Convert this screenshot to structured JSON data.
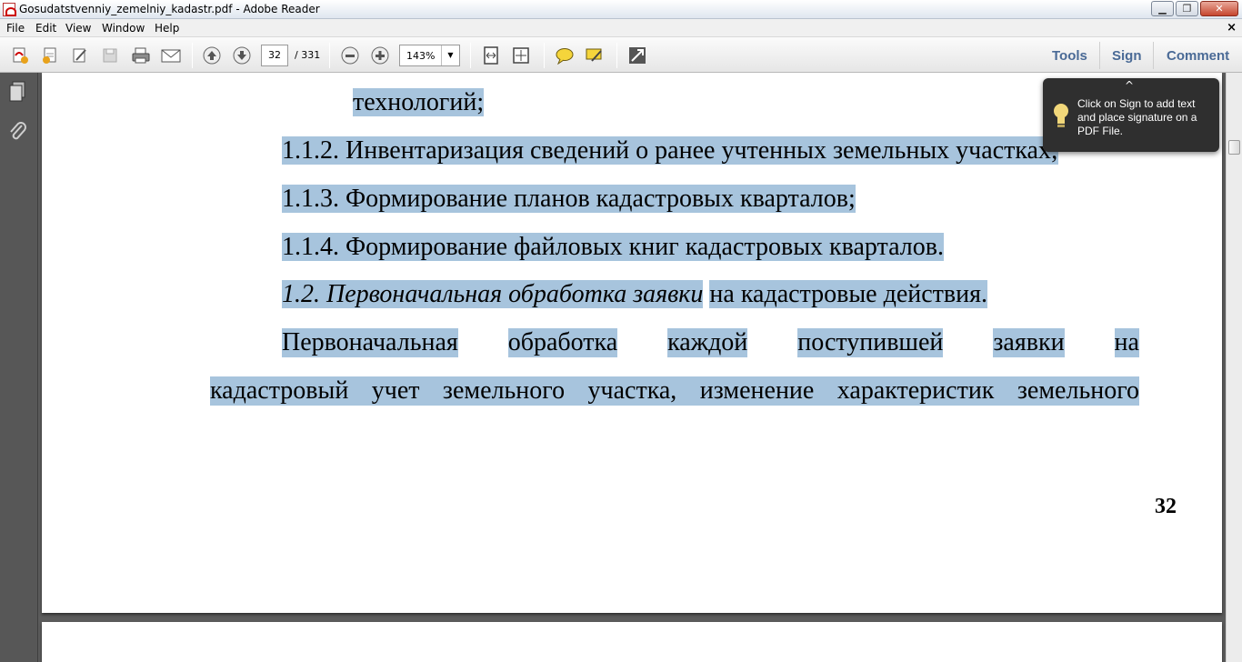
{
  "window": {
    "title": "Gosudatstvenniy_zemelniy_kadastr.pdf - Adobe Reader",
    "controls": {
      "minimize": "▁",
      "maximize": "❐",
      "close": "✕"
    }
  },
  "menubar": {
    "items": [
      "File",
      "Edit",
      "View",
      "Window",
      "Help"
    ],
    "close_document": "×"
  },
  "toolbar": {
    "buttons": [
      "create-pdf-icon",
      "export-icon",
      "edit-icon",
      "save-icon",
      "print-icon",
      "email-icon",
      "previous-page-icon",
      "next-page-icon",
      "zoom-out-icon",
      "zoom-in-icon",
      "fit-page-icon",
      "fit-width-icon",
      "comment-icon",
      "highlight-icon",
      "fullscreen-icon"
    ],
    "page_current": "32",
    "page_total": "/ 331",
    "zoom": "143%",
    "panes": [
      "Tools",
      "Sign",
      "Comment"
    ]
  },
  "document": {
    "lines": [
      {
        "text": "технологий;"
      },
      {
        "num": "1.1.2.",
        "text": "Инвентаризация сведений о ранее учтенных земельных участках;"
      },
      {
        "num": "1.1.3.",
        "text": "Формирование планов кадастровых кварталов;"
      },
      {
        "num": "1.1.4.",
        "text": "Формирование файловых книг кадастровых кварталов."
      },
      {
        "italic": "1.2. Первоначальная обработка заявки",
        "text": "на кадастровые действия."
      },
      {
        "words": [
          "Первоначальная",
          "обработка",
          "каждой",
          "поступившей",
          "заявки",
          "на"
        ]
      },
      {
        "text": "кадастровый учет земельного участка, изменение характеристик земельного"
      }
    ],
    "page_number": "32"
  },
  "tooltip": {
    "text": "Click on Sign to add text and place signature on a PDF File.",
    "chevron": "^"
  }
}
